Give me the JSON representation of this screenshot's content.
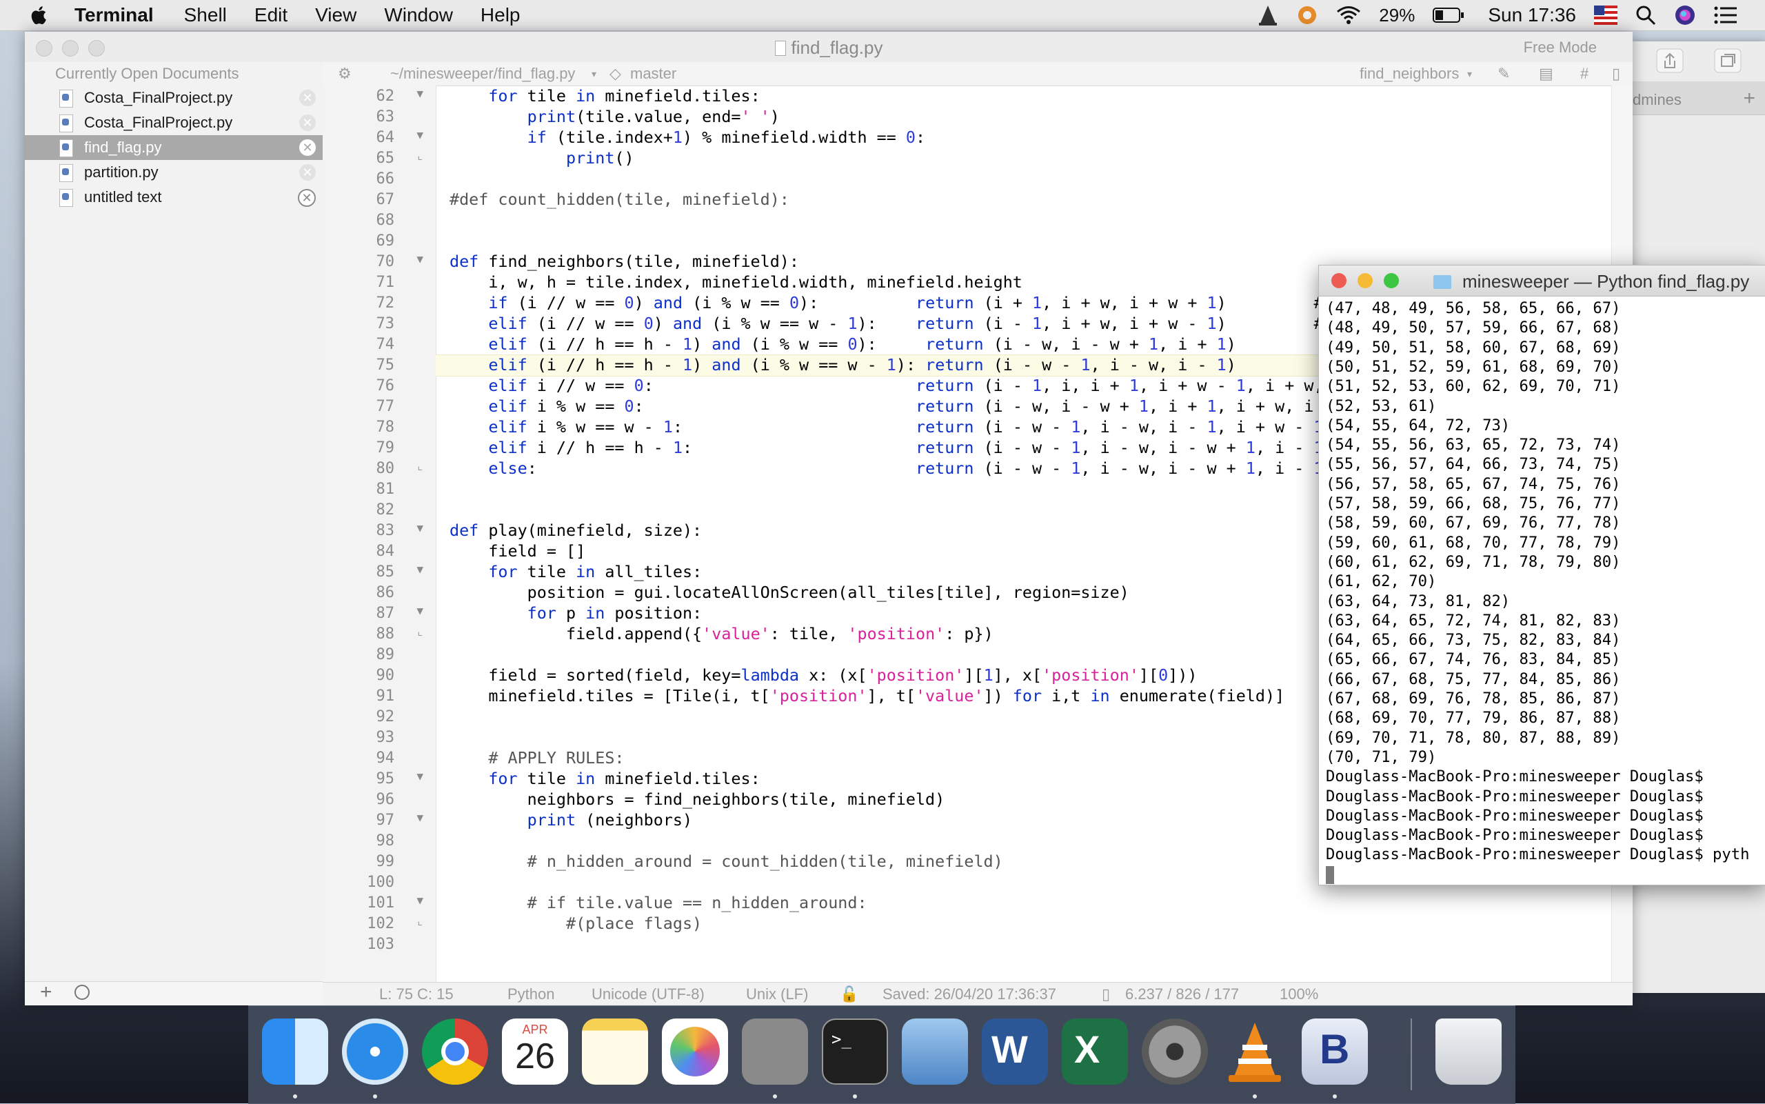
{
  "menubar": {
    "app": "Terminal",
    "items": [
      "Shell",
      "Edit",
      "View",
      "Window",
      "Help"
    ],
    "battery": "29%",
    "clock": "Sun 17:36"
  },
  "editor": {
    "title": "find_flag.py",
    "mode": "Free Mode",
    "sidebar_header": "Currently Open Documents",
    "documents": [
      "Costa_FinalProject.py",
      "Costa_FinalProject.py",
      "find_flag.py",
      "partition.py",
      "untitled text"
    ],
    "navbar": {
      "path": "~/minesweeper/find_flag.py",
      "branch": "master",
      "symbol": "find_neighbors"
    },
    "statusbar": {
      "position": "L: 75 C: 15",
      "syntax": "Python",
      "encoding": "Unicode (UTF-8)",
      "line_endings": "Unix (LF)",
      "saved": "Saved: 26/04/20 17:36:37",
      "stats": "6.237 / 826 / 177",
      "zoom": "100%"
    },
    "background_tab": "dmines",
    "code_lines": [
      {
        "n": "62",
        "t": "    for tile in minefield.tiles:"
      },
      {
        "n": "63",
        "t": "        print(tile.value, end=' ')"
      },
      {
        "n": "64",
        "t": "        if (tile.index+1) % minefield.width == 0:"
      },
      {
        "n": "65",
        "t": "            print()"
      },
      {
        "n": "66",
        "t": ""
      },
      {
        "n": "67",
        "t": "#def count_hidden(tile, minefield):"
      },
      {
        "n": "68",
        "t": ""
      },
      {
        "n": "69",
        "t": ""
      },
      {
        "n": "70",
        "t": "def find_neighbors(tile, minefield):"
      },
      {
        "n": "71",
        "t": "    i, w, h = tile.index, minefield.width, minefield.height"
      },
      {
        "n": "72",
        "t": "    if (i // w == 0) and (i % w == 0):          return (i + 1, i + w, i + w + 1)         #"
      },
      {
        "n": "73",
        "t": "    elif (i // w == 0) and (i % w == w - 1):    return (i - 1, i + w, i + w - 1)         #"
      },
      {
        "n": "74",
        "t": "    elif (i // h == h - 1) and (i % w == 0):     return (i - w, i - w + 1, i + 1)         #"
      },
      {
        "n": "75",
        "t": "    elif (i // h == h - 1) and (i % w == w - 1): return (i - w - 1, i - w, i - 1)         #"
      },
      {
        "n": "76",
        "t": "    elif i // w == 0:                           return (i - 1, i, i + 1, i + w - 1, i + w,"
      },
      {
        "n": "77",
        "t": "    elif i % w == 0:                            return (i - w, i - w + 1, i + 1, i + w, i"
      },
      {
        "n": "78",
        "t": "    elif i % w == w - 1:                        return (i - w - 1, i - w, i - 1, i + w - 1"
      },
      {
        "n": "79",
        "t": "    elif i // h == h - 1:                       return (i - w - 1, i - w, i - w + 1, i - 1"
      },
      {
        "n": "80",
        "t": "    else:                                       return (i - w - 1, i - w, i - w + 1, i - 1"
      },
      {
        "n": "81",
        "t": ""
      },
      {
        "n": "82",
        "t": ""
      },
      {
        "n": "83",
        "t": "def play(minefield, size):"
      },
      {
        "n": "84",
        "t": "    field = []"
      },
      {
        "n": "85",
        "t": "    for tile in all_tiles:"
      },
      {
        "n": "86",
        "t": "        position = gui.locateAllOnScreen(all_tiles[tile], region=size)"
      },
      {
        "n": "87",
        "t": "        for p in position:"
      },
      {
        "n": "88",
        "t": "            field.append({'value': tile, 'position': p})"
      },
      {
        "n": "89",
        "t": ""
      },
      {
        "n": "90",
        "t": "    field = sorted(field, key=lambda x: (x['position'][1], x['position'][0]))"
      },
      {
        "n": "91",
        "t": "    minefield.tiles = [Tile(i, t['position'], t['value']) for i,t in enumerate(field)]"
      },
      {
        "n": "92",
        "t": ""
      },
      {
        "n": "93",
        "t": ""
      },
      {
        "n": "94",
        "t": "    # APPLY RULES:"
      },
      {
        "n": "95",
        "t": "    for tile in minefield.tiles:"
      },
      {
        "n": "96",
        "t": "        neighbors = find_neighbors(tile, minefield)"
      },
      {
        "n": "97",
        "t": "        print (neighbors)"
      },
      {
        "n": "98",
        "t": ""
      },
      {
        "n": "99",
        "t": "        # n_hidden_around = count_hidden(tile, minefield)"
      },
      {
        "n": "100",
        "t": ""
      },
      {
        "n": "101",
        "t": "        # if tile.value == n_hidden_around:"
      },
      {
        "n": "102",
        "t": "            #(place flags)"
      },
      {
        "n": "103",
        "t": ""
      }
    ]
  },
  "terminal": {
    "title": "minesweeper — Python find_flag.py",
    "lines": [
      "(47, 48, 49, 56, 58, 65, 66, 67)",
      "(48, 49, 50, 57, 59, 66, 67, 68)",
      "(49, 50, 51, 58, 60, 67, 68, 69)",
      "(50, 51, 52, 59, 61, 68, 69, 70)",
      "(51, 52, 53, 60, 62, 69, 70, 71)",
      "(52, 53, 61)",
      "(54, 55, 64, 72, 73)",
      "(54, 55, 56, 63, 65, 72, 73, 74)",
      "(55, 56, 57, 64, 66, 73, 74, 75)",
      "(56, 57, 58, 65, 67, 74, 75, 76)",
      "(57, 58, 59, 66, 68, 75, 76, 77)",
      "(58, 59, 60, 67, 69, 76, 77, 78)",
      "(59, 60, 61, 68, 70, 77, 78, 79)",
      "(60, 61, 62, 69, 71, 78, 79, 80)",
      "(61, 62, 70)",
      "(63, 64, 73, 81, 82)",
      "(63, 64, 65, 72, 74, 81, 82, 83)",
      "(64, 65, 66, 73, 75, 82, 83, 84)",
      "(65, 66, 67, 74, 76, 83, 84, 85)",
      "(66, 67, 68, 75, 77, 84, 85, 86)",
      "(67, 68, 69, 76, 78, 85, 86, 87)",
      "(68, 69, 70, 77, 79, 86, 87, 88)",
      "(69, 70, 71, 78, 80, 87, 88, 89)",
      "(70, 71, 79)",
      "Douglass-MacBook-Pro:minesweeper Douglas$",
      "Douglass-MacBook-Pro:minesweeper Douglas$",
      "Douglass-MacBook-Pro:minesweeper Douglas$",
      "Douglass-MacBook-Pro:minesweeper Douglas$",
      "Douglass-MacBook-Pro:minesweeper Douglas$ pyth"
    ]
  },
  "dock": {
    "calendar_month": "APR",
    "calendar_day": "26",
    "apps": [
      "finder-icon",
      "safari-icon",
      "chrome-icon",
      "calendar-icon",
      "notes-icon",
      "photos-icon",
      "calculator-icon",
      "terminal-icon",
      "preview-icon",
      "word-icon",
      "excel-icon",
      "system-preferences-icon",
      "vlc-icon",
      "bbedit-icon",
      "trash-icon"
    ]
  },
  "colors": {
    "keyword": "#0b2fc9",
    "string": "#d8219b",
    "number": "#2c3bd9",
    "comment": "#555555"
  }
}
